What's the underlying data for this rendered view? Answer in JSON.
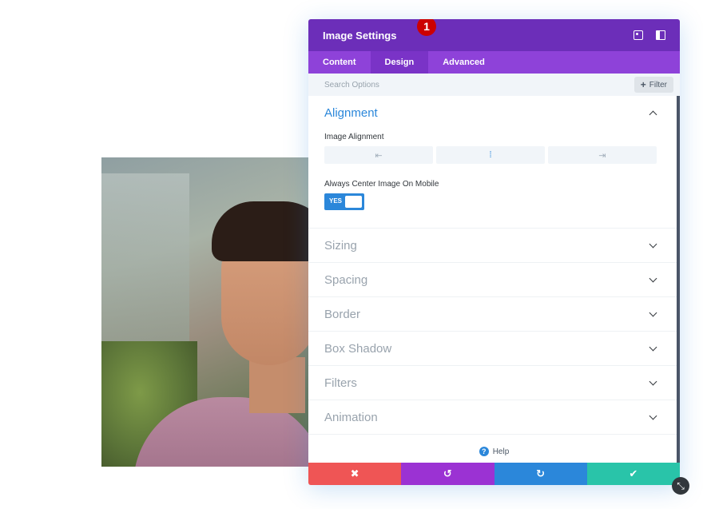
{
  "panel": {
    "title": "Image Settings",
    "colors": {
      "header": "#6c2eb9",
      "tabs": "#8e42d9",
      "accent": "#2b87da"
    }
  },
  "tabs": [
    {
      "label": "Content",
      "active": false
    },
    {
      "label": "Design",
      "active": true
    },
    {
      "label": "Advanced",
      "active": false
    }
  ],
  "search": {
    "placeholder": "Search Options",
    "filter_label": "Filter"
  },
  "alignment": {
    "title": "Alignment",
    "image_alignment_label": "Image Alignment",
    "options": [
      {
        "icon": "align-left-icon",
        "glyph": "⇤",
        "active": false
      },
      {
        "icon": "align-center-icon",
        "glyph": "⁞",
        "active": true
      },
      {
        "icon": "align-right-icon",
        "glyph": "⇥",
        "active": false
      }
    ],
    "badge": "1",
    "mobile_center_label": "Always Center Image On Mobile",
    "toggle_text": "YES"
  },
  "sections": [
    {
      "label": "Sizing"
    },
    {
      "label": "Spacing"
    },
    {
      "label": "Border"
    },
    {
      "label": "Box Shadow"
    },
    {
      "label": "Filters"
    },
    {
      "label": "Animation"
    }
  ],
  "help": {
    "label": "Help",
    "icon": "?"
  },
  "footer": {
    "cancel": {
      "glyph": "✖",
      "color": "#ef5555"
    },
    "undo": {
      "glyph": "↺",
      "color": "#9b32d3"
    },
    "redo": {
      "glyph": "↻",
      "color": "#2b87da"
    },
    "save": {
      "glyph": "✔",
      "color": "#29c4a9"
    }
  }
}
